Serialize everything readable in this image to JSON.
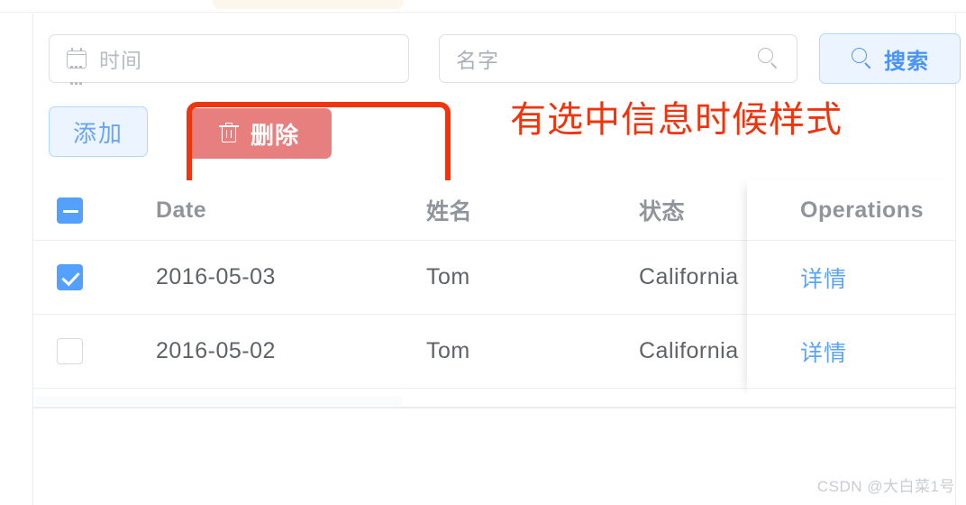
{
  "filters": {
    "date_input": {
      "placeholder": "时间",
      "value": "",
      "icon": "calendar-icon"
    },
    "name_input": {
      "placeholder": "名字",
      "value": "",
      "icon": "search-icon"
    },
    "search_button": {
      "label": "搜索",
      "icon": "search-icon"
    }
  },
  "actions": {
    "add_button": {
      "label": "添加"
    },
    "delete_button": {
      "label": "删除",
      "icon": "trash-icon"
    }
  },
  "annotation": {
    "text": "有选中信息时候样式",
    "color": "#f0340e"
  },
  "table": {
    "columns": [
      {
        "key": "selection",
        "label": ""
      },
      {
        "key": "date",
        "label": "Date"
      },
      {
        "key": "name",
        "label": "姓名"
      },
      {
        "key": "state",
        "label": "状态"
      },
      {
        "key": "operations",
        "label": "Operations"
      }
    ],
    "header_checkbox_state": "indeterminate",
    "rows": [
      {
        "checked": true,
        "date": "2016-05-03",
        "name": "Tom",
        "state": "California",
        "operation_label": "详情"
      },
      {
        "checked": false,
        "date": "2016-05-02",
        "name": "Tom",
        "state": "California",
        "operation_label": "详情"
      }
    ]
  },
  "colors": {
    "primary": "#53a0fd",
    "danger": "#e87f7f",
    "annotation": "#f0340e",
    "light_blue_bg": "#ecf5ff",
    "border": "#ebeef5"
  },
  "watermark": {
    "text": "CSDN @大白菜1号"
  }
}
